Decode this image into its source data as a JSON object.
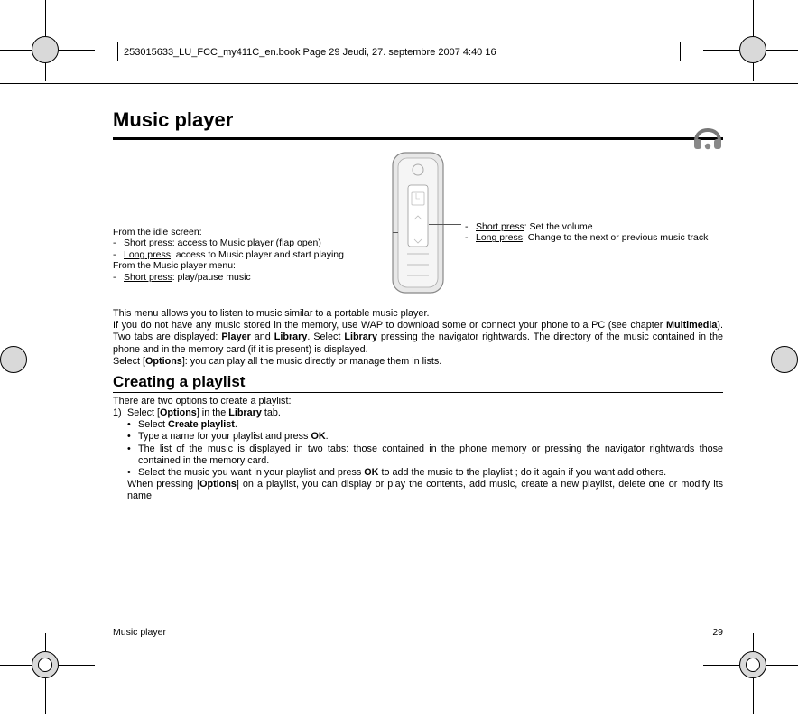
{
  "header_line": "253015633_LU_FCC_my411C_en.book  Page 29  Jeudi, 27. septembre 2007  4:40 16",
  "title": "Music player",
  "left_callout": {
    "line1": "From the idle screen:",
    "item1_label": "Short press",
    "item1_text": ": access to Music player (flap open)",
    "item2_label": "Long press",
    "item2_text": ": access to Music player and start playing",
    "line2": "From the Music player menu:",
    "item3_label": "Short press",
    "item3_text": ": play/pause music"
  },
  "right_callout": {
    "item1_label": "Short press",
    "item1_text": ": Set the volume",
    "item2_label": "Long press",
    "item2_text": ": Change to the next or previous music track"
  },
  "body": {
    "p1": "This menu allows you to listen to music similar to a portable music player.",
    "p2a": "If you do not have any music stored in the memory, use WAP to download some or connect your phone to a PC (see chapter ",
    "p2b": "Multimedia",
    "p2c": "). Two tabs are displayed: ",
    "p2d": "Player",
    "p2e": " and ",
    "p2f": "Library",
    "p2g": ". Select ",
    "p2h": "Library",
    "p2i": " pressing the navigator rightwards. The directory of the music contained in the phone and in the memory card (if it is present) is displayed.",
    "p3a": "Select [",
    "p3b": "Options",
    "p3c": "]: you can play all the music directly or manage them in lists."
  },
  "section_title": "Creating a playlist",
  "playlist": {
    "intro": "There are two options to create a playlist:",
    "step1a": "Select [",
    "step1b": "Options",
    "step1c": "] in the ",
    "step1d": "Library",
    "step1e": " tab.",
    "b1a": "Select ",
    "b1b": "Create playlist",
    "b1c": ".",
    "b2a": "Type a name for your playlist and press ",
    "b2b": "OK",
    "b2c": ".",
    "b3": "The list of the music is displayed in two tabs: those contained in the phone memory or pressing the navigator rightwards those contained in the memory card.",
    "b4a": "Select the music you want in your playlist and press ",
    "b4b": "OK",
    "b4c": " to add the music to the playlist ; do it again if you want add others.",
    "note_a": "When pressing [",
    "note_b": "Options",
    "note_c": "] on a playlist, you can display or play the contents, add music, create a new playlist, delete one or modify its name."
  },
  "footer_left": "Music player",
  "footer_right": "29"
}
